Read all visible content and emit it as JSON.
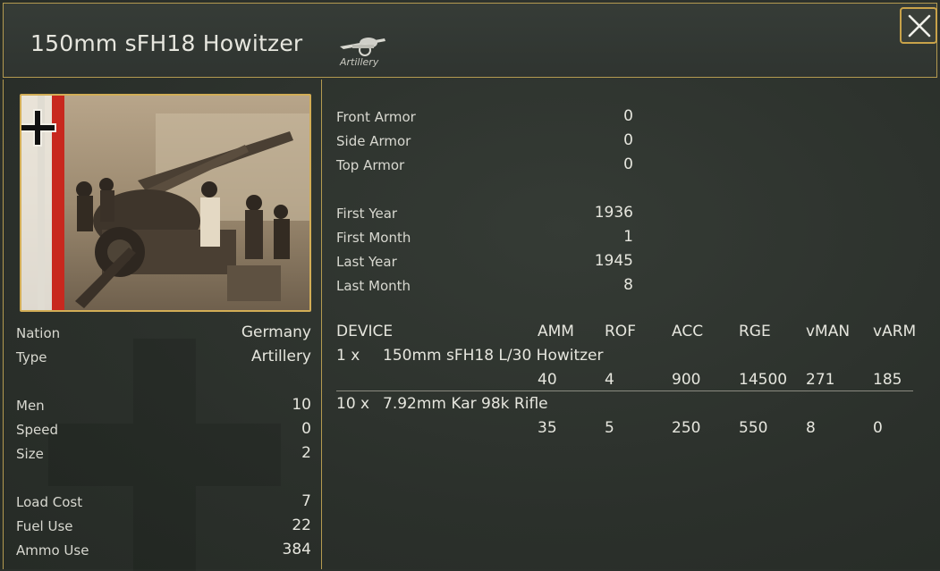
{
  "header": {
    "title": "150mm sFH18 Howitzer",
    "type_label": "Artillery"
  },
  "left": {
    "stats_group1": [
      {
        "label": "Nation",
        "value": "Germany"
      },
      {
        "label": "Type",
        "value": "Artillery"
      }
    ],
    "stats_group2": [
      {
        "label": "Men",
        "value": "10"
      },
      {
        "label": "Speed",
        "value": "0"
      },
      {
        "label": "Size",
        "value": "2"
      }
    ],
    "stats_group3": [
      {
        "label": "Load Cost",
        "value": "7"
      },
      {
        "label": "Fuel Use",
        "value": "22"
      },
      {
        "label": "Ammo Use",
        "value": "384"
      }
    ]
  },
  "armor": [
    {
      "label": "Front Armor",
      "value": "0"
    },
    {
      "label": "Side Armor",
      "value": "0"
    },
    {
      "label": "Top Armor",
      "value": "0"
    }
  ],
  "dates": [
    {
      "label": "First Year",
      "value": "1936"
    },
    {
      "label": "First Month",
      "value": "1"
    },
    {
      "label": "Last Year",
      "value": "1945"
    },
    {
      "label": "Last Month",
      "value": "8"
    }
  ],
  "devices": {
    "headers": [
      "DEVICE",
      "AMM",
      "ROF",
      "ACC",
      "RGE",
      "vMAN",
      "vARM"
    ],
    "rows": [
      {
        "qty": "1 x",
        "name": "150mm sFH18 L/30 Howitzer",
        "values": [
          "40",
          "4",
          "900",
          "14500",
          "271",
          "185"
        ]
      },
      {
        "qty": "10 x",
        "name": "7.92mm Kar 98k Rifle",
        "values": [
          "35",
          "5",
          "250",
          "550",
          "8",
          "0"
        ]
      }
    ]
  },
  "colors": {
    "accent_gold": "#c8a24a",
    "background": "#2b302b",
    "flag_red": "#c8281e"
  },
  "icons": {
    "close": "close-icon",
    "type": "artillery-icon",
    "flag": "german-cross-icon"
  }
}
